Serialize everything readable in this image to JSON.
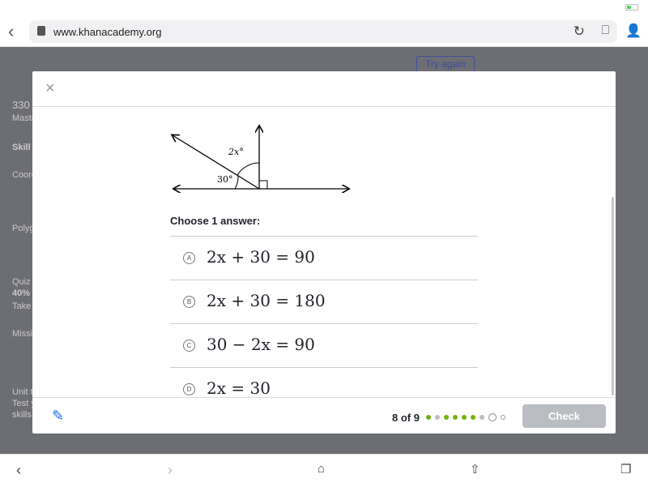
{
  "browser": {
    "url": "www.khanacademy.org"
  },
  "background": {
    "try_again": "Try again",
    "items": [
      "330",
      "Maste",
      "Skill",
      "Coord",
      "Polyg",
      "Quiz",
      "40%",
      "Take",
      "Missi",
      "Unit t",
      "Test y",
      "skills"
    ]
  },
  "question": {
    "figure_labels": {
      "angle_top": "2x°",
      "angle_left": "30°"
    },
    "prompt": "Choose 1 answer:",
    "choices": [
      {
        "letter": "A",
        "text": "2x + 30 = 90"
      },
      {
        "letter": "B",
        "text": "2x + 30 = 180"
      },
      {
        "letter": "C",
        "text": "30 − 2x = 90"
      },
      {
        "letter": "D",
        "text": "2x = 30"
      }
    ]
  },
  "footer": {
    "progress": "8 of 9",
    "check_label": "Check",
    "dots": [
      "correct",
      "incorrect",
      "correct",
      "correct",
      "correct",
      "correct",
      "incorrect",
      "current",
      "upcoming"
    ],
    "colors": {
      "correct": "#71b307",
      "incorrect": "#babec2",
      "current": "#ffffff",
      "upcoming": "#ffffff"
    }
  }
}
